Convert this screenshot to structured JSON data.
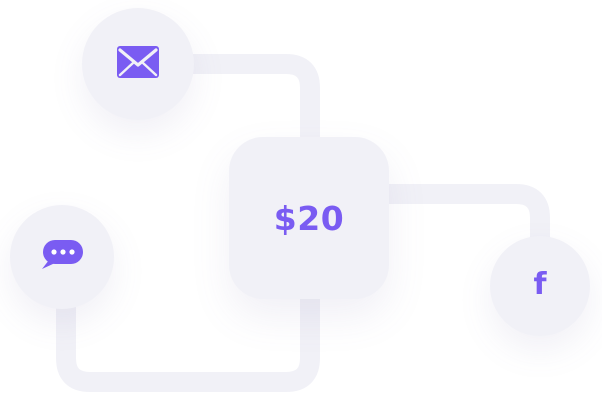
{
  "accent_color": "#7a5cf2",
  "background_color": "#ffffff",
  "node_color": "#f1f1f7",
  "center": {
    "amount": "$20"
  },
  "nodes": {
    "email": {
      "icon": "envelope-icon"
    },
    "chat": {
      "icon": "chat-bubble-icon"
    },
    "facebook": {
      "icon": "facebook-icon",
      "glyph": "f"
    }
  }
}
